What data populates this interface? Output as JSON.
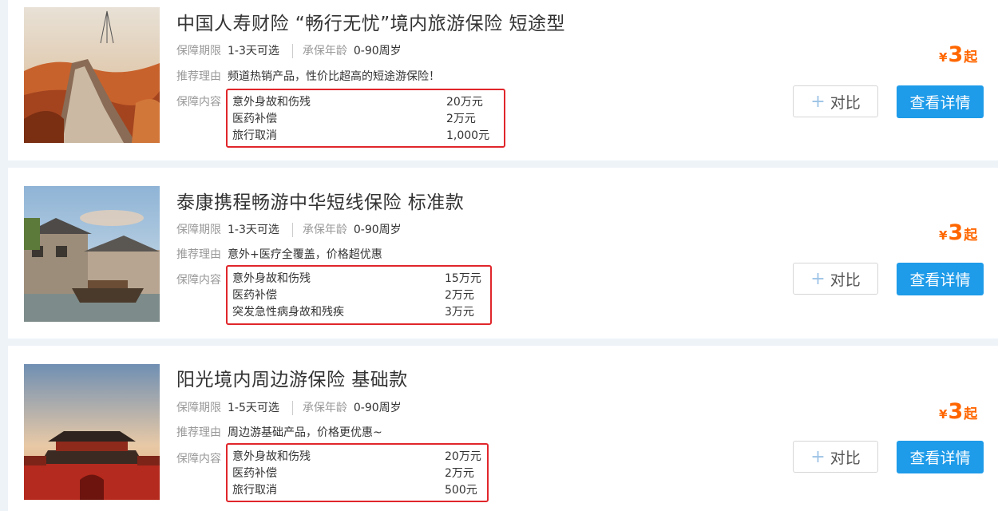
{
  "labels": {
    "period": "保障期限",
    "age": "承保年龄",
    "reason": "推荐理由",
    "coverage": "保障内容"
  },
  "buttons": {
    "compare_plus": "+",
    "compare": "对比",
    "details": "查看详情"
  },
  "price_suffix": "起",
  "currency": "¥",
  "products": [
    {
      "title": "中国人寿财险 “畅行无忧”境内旅游保险 短途型",
      "period": "1-3天可选",
      "age": "0-90周岁",
      "reason": "频道热销产品，性价比超高的短途游保险！",
      "coverage": [
        {
          "item": "意外身故和伤残",
          "amount": "20万元"
        },
        {
          "item": "医药补偿",
          "amount": "2万元"
        },
        {
          "item": "旅行取消",
          "amount": "1,000元"
        }
      ],
      "price": "3",
      "image": "great-wall-image"
    },
    {
      "title": "泰康携程畅游中华短线保险 标准款",
      "period": "1-3天可选",
      "age": "0-90周岁",
      "reason": "意外+医疗全覆盖，价格超优惠",
      "coverage": [
        {
          "item": "意外身故和伤残",
          "amount": "15万元"
        },
        {
          "item": "医药补偿",
          "amount": "2万元"
        },
        {
          "item": "突发急性病身故和残疾",
          "amount": "3万元"
        }
      ],
      "price": "3",
      "image": "water-town-image"
    },
    {
      "title": "阳光境内周边游保险 基础款",
      "period": "1-5天可选",
      "age": "0-90周岁",
      "reason": "周边游基础产品，价格更优惠~",
      "coverage": [
        {
          "item": "意外身故和伤残",
          "amount": "20万元"
        },
        {
          "item": "医药补偿",
          "amount": "2万元"
        },
        {
          "item": "旅行取消",
          "amount": "500元"
        }
      ],
      "price": "3",
      "image": "palace-gate-image"
    }
  ],
  "colors": {
    "accent": "#1e9be9",
    "price": "#ff6600",
    "highlight_border": "#e0262b"
  }
}
